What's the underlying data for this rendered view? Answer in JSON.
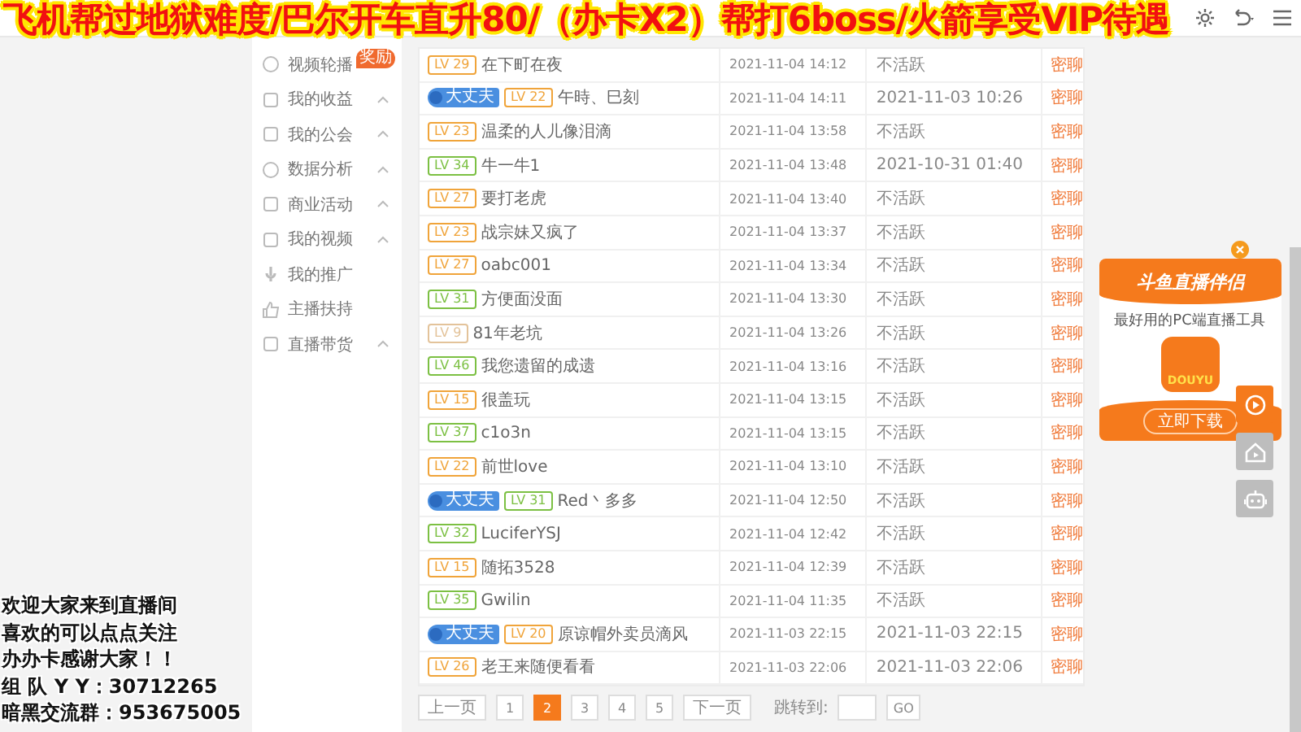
{
  "stream_title": "飞机帮过地狱难度/巴尔开车直升80/（办卡X2）帮打6boss/火箭享受VIP待遇",
  "sidebar": {
    "items": [
      {
        "label": "视频轮播",
        "kind": "link",
        "tag": "奖励"
      },
      {
        "label": "我的收益",
        "kind": "group"
      },
      {
        "label": "我的公会",
        "kind": "group"
      },
      {
        "label": "数据分析",
        "kind": "group"
      },
      {
        "label": "商业活动",
        "kind": "group"
      },
      {
        "label": "我的视频",
        "kind": "group"
      },
      {
        "label": "我的推广",
        "kind": "link"
      },
      {
        "label": "主播扶持",
        "kind": "link"
      },
      {
        "label": "直播带货",
        "kind": "group"
      }
    ]
  },
  "table": {
    "rows": [
      {
        "level_tag": {
          "text": "LV 29",
          "color": "#f0a43a"
        },
        "name": "在下町在夜",
        "time": "2021-11-04 14:12",
        "status": "不活跃",
        "action": "密聊"
      },
      {
        "fan_badge": "大丈夫",
        "level_tag": {
          "text": "LV 22",
          "color": "#f0a43a"
        },
        "name": "午時、巳刻",
        "time": "2021-11-04 14:11",
        "status": "2021-11-03 10:26",
        "action": "密聊"
      },
      {
        "level_tag": {
          "text": "LV 23",
          "color": "#f0a43a"
        },
        "name": "温柔的人儿像泪滴",
        "time": "2021-11-04 13:58",
        "status": "不活跃",
        "action": "密聊"
      },
      {
        "level_tag": {
          "text": "LV 34",
          "color": "#7cc043"
        },
        "name": "牛一牛1",
        "time": "2021-11-04 13:48",
        "status": "2021-10-31 01:40",
        "action": "密聊"
      },
      {
        "level_tag": {
          "text": "LV 27",
          "color": "#f0a43a"
        },
        "name": "要打老虎",
        "time": "2021-11-04 13:40",
        "status": "不活跃",
        "action": "密聊"
      },
      {
        "level_tag": {
          "text": "LV 23",
          "color": "#f0a43a"
        },
        "name": "战宗妹又疯了",
        "time": "2021-11-04 13:37",
        "status": "不活跃",
        "action": "密聊"
      },
      {
        "level_tag": {
          "text": "LV 27",
          "color": "#f0a43a"
        },
        "name": "oabc001",
        "time": "2021-11-04 13:34",
        "status": "不活跃",
        "action": "密聊"
      },
      {
        "level_tag": {
          "text": "LV 31",
          "color": "#7cc043"
        },
        "name": "方便面没面",
        "time": "2021-11-04 13:30",
        "status": "不活跃",
        "action": "密聊"
      },
      {
        "level_tag": {
          "text": "LV 9",
          "color": "#e3c39a"
        },
        "name": "81年老坑",
        "time": "2021-11-04 13:26",
        "status": "不活跃",
        "action": "密聊"
      },
      {
        "level_tag": {
          "text": "LV 46",
          "color": "#7cc043"
        },
        "name": "我您遗留的成遗",
        "time": "2021-11-04 13:16",
        "status": "不活跃",
        "action": "密聊"
      },
      {
        "level_tag": {
          "text": "LV 15",
          "color": "#f0a43a"
        },
        "name": "很盖玩",
        "time": "2021-11-04 13:15",
        "status": "不活跃",
        "action": "密聊"
      },
      {
        "level_tag": {
          "text": "LV 37",
          "color": "#7cc043"
        },
        "name": "c1o3n",
        "time": "2021-11-04 13:15",
        "status": "不活跃",
        "action": "密聊"
      },
      {
        "level_tag": {
          "text": "LV 22",
          "color": "#f0a43a"
        },
        "name": "前世love",
        "time": "2021-11-04 13:10",
        "status": "不活跃",
        "action": "密聊"
      },
      {
        "fan_badge": "大丈夫",
        "level_tag": {
          "text": "LV 31",
          "color": "#7cc043"
        },
        "name": "Red丶多多",
        "time": "2021-11-04 12:50",
        "status": "不活跃",
        "action": "密聊"
      },
      {
        "level_tag": {
          "text": "LV 32",
          "color": "#7cc043"
        },
        "name": "LuciferYSJ",
        "time": "2021-11-04 12:42",
        "status": "不活跃",
        "action": "密聊"
      },
      {
        "level_tag": {
          "text": "LV 15",
          "color": "#f0a43a"
        },
        "name": "随拓3528",
        "time": "2021-11-04 12:39",
        "status": "不活跃",
        "action": "密聊"
      },
      {
        "level_tag": {
          "text": "LV 35",
          "color": "#7cc043"
        },
        "name": "Gwilin",
        "time": "2021-11-04 11:35",
        "status": "不活跃",
        "action": "密聊"
      },
      {
        "fan_badge": "大丈夫",
        "level_tag": {
          "text": "LV 20",
          "color": "#f0a43a"
        },
        "name": "原谅帽外卖员滴风",
        "time": "2021-11-03 22:15",
        "status": "2021-11-03 22:15",
        "action": "密聊"
      },
      {
        "level_tag": {
          "text": "LV 26",
          "color": "#f0a43a"
        },
        "name": "老王来随便看看",
        "time": "2021-11-03 22:06",
        "status": "2021-11-03 22:06",
        "action": "密聊"
      }
    ]
  },
  "pagination": {
    "prev": "上一页",
    "pages": [
      {
        "label": "1",
        "selected": false
      },
      {
        "label": "2",
        "selected": true
      },
      {
        "label": "3",
        "selected": false
      },
      {
        "label": "4",
        "selected": false
      },
      {
        "label": "5",
        "selected": false
      }
    ],
    "next": "下一页",
    "jump_label": "跳转到:",
    "go": "GO"
  },
  "ad": {
    "title": "斗鱼直播伴侣",
    "subtitle": "最好用的PC端直播工具",
    "logo_text": "DOUYU",
    "button": "立即下载"
  },
  "overlay_lines": [
    "欢迎大家来到直播间",
    "喜欢的可以点点关注",
    "办办卡感谢大家！！",
    "组 队 Y Y：30712265",
    "暗黑交流群：953675005"
  ]
}
